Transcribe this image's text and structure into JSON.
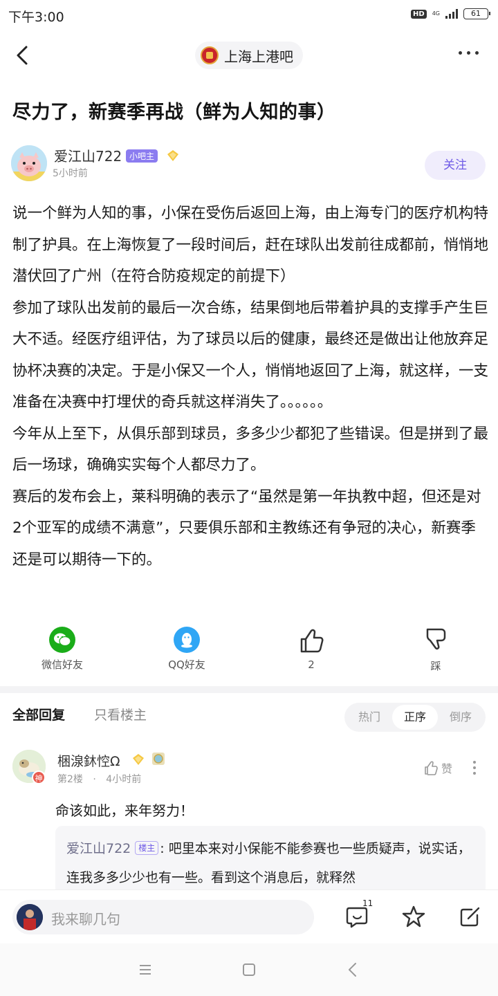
{
  "status_bar": {
    "time": "下午3:00",
    "hd": "HD",
    "network": "4G",
    "battery": "61"
  },
  "nav": {
    "forum_name": "上海上港吧"
  },
  "post": {
    "title": "尽力了，新赛季再战（鲜为人知的事）",
    "author": {
      "name": "爱江山722",
      "badge": "小吧主",
      "time": "5小时前"
    },
    "follow_label": "关注",
    "paragraphs": [
      "说一个鲜为人知的事，小保在受伤后返回上海，由上海专门的医疗机构特制了护具。在上海恢复了一段时间后，赶在球队出发前往成都前，悄悄地潜伏回了广州（在符合防疫规定的前提下）",
      "参加了球队出发前的最后一次合练，结果倒地后带着护具的支撑手产生巨大不适。经医疗组评估，为了球员以后的健康，最终还是做出让他放弃足协杯决赛的决定。于是小保又一个人，悄悄地返回了上海，就这样，一支准备在决赛中打埋伏的奇兵就这样消失了。。。。。。",
      "今年从上至下，从俱乐部到球员，多多少少都犯了些错误。但是拼到了最后一场球，确确实实每个人都尽力了。",
      "赛后的发布会上，莱科明确的表示了“虽然是第一年执教中超，但还是对2个亚军的成绩不满意”，只要俱乐部和主教练还有争冠的决心，新赛季还是可以期待一下的。"
    ]
  },
  "share": {
    "wechat": "微信好友",
    "qq": "QQ好友",
    "like_count": "2",
    "dislike": "踩"
  },
  "reply_tabs": {
    "all": "全部回复",
    "op_only": "只看楼主",
    "sort": [
      "热门",
      "正序",
      "倒序"
    ],
    "active_sort": "正序"
  },
  "comment": {
    "user": "梱湶鈢悾Ω",
    "god_badge": "神",
    "floor": "第2楼",
    "separator": "·",
    "time": "4小时前",
    "like_label": "赞",
    "text": "命该如此，来年努力！",
    "quote": {
      "name": "爱江山722",
      "badge": "楼主",
      "text": ": 吧里本来对小保能不能参赛也一些质疑声，说实话，连我多多少少也有一些。看到这个消息后，就释然"
    }
  },
  "bottom_bar": {
    "placeholder": "我来聊几句",
    "comment_count": "11"
  },
  "colors": {
    "accent": "#6e5ae6",
    "wechat": "#1aad19",
    "qq": "#2fa6f5"
  }
}
